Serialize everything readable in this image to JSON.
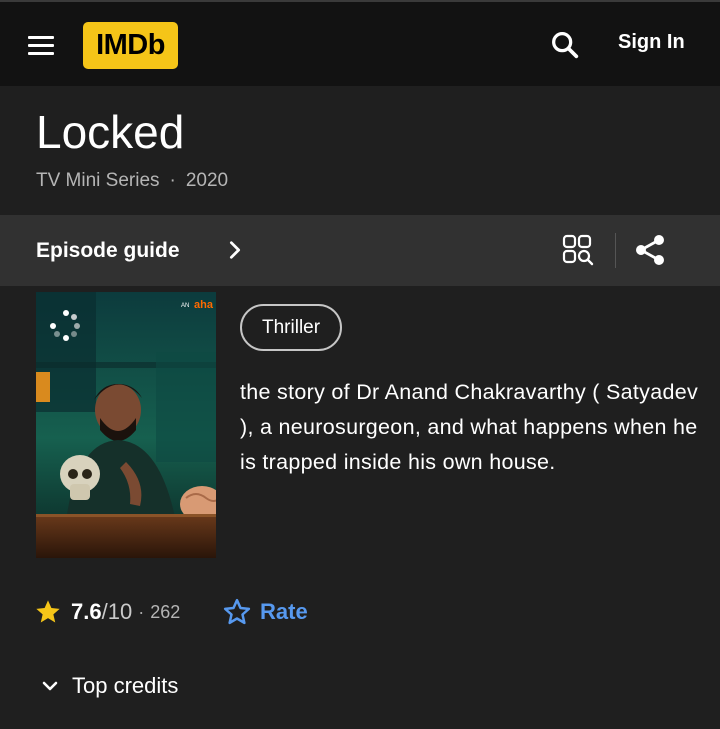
{
  "header": {
    "logo_text": "IMDb",
    "logo_color": "#f5c518",
    "menu_icon": "hamburger-menu-icon",
    "search_icon": "search-icon",
    "signin_label": "Sign In"
  },
  "title": {
    "name": "Locked",
    "type": "TV Mini Series",
    "separator": "·",
    "year": "2020"
  },
  "episode_bar": {
    "label": "Episode guide",
    "chevron_icon": "chevron-right-icon",
    "grid_icon": "grid-search-icon",
    "share_icon": "share-icon"
  },
  "poster": {
    "badge_prefix": "AN",
    "badge_brand": "aha",
    "loading_icon": "spinner-icon"
  },
  "genre": {
    "label": "Thriller"
  },
  "plot": {
    "text": "the story of Dr Anand Chakravarthy ( Satyadev ), a neurosurgeon, and what happens when he is trapped inside his own house."
  },
  "rating": {
    "score": "7.6",
    "max": "/10",
    "separator": "·",
    "count": "262",
    "star_color": "#f5c518"
  },
  "rate": {
    "label": "Rate",
    "accent": "#5799ef"
  },
  "credits": {
    "label": "Top credits"
  }
}
